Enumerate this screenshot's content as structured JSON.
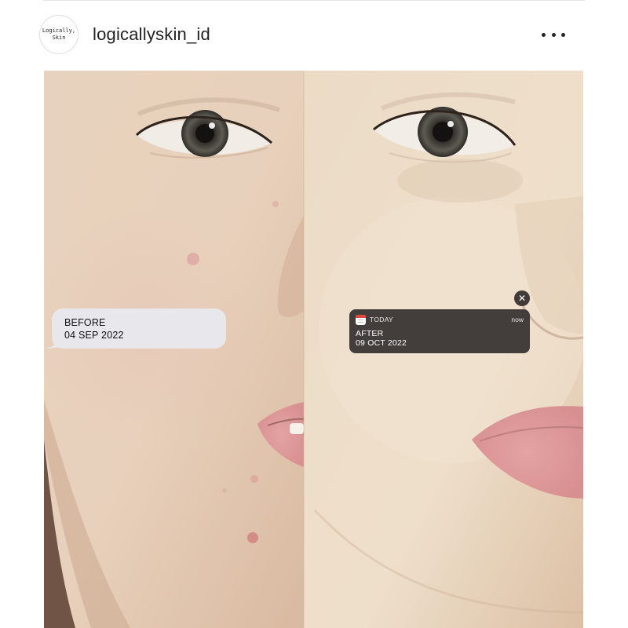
{
  "post": {
    "username": "logicallyskin_id",
    "avatar_text": "Logically,\nSkin",
    "more_icon": "more-horizontal-icon"
  },
  "image": {
    "before": {
      "label": "BEFORE",
      "date": "04 SEP 2022"
    },
    "after_notification": {
      "app_name": "TODAY",
      "time": "now",
      "label": "AFTER",
      "date": "09 OCT 2022",
      "close_symbol": "✕",
      "icon": "calendar-icon"
    }
  },
  "colors": {
    "bubble_bg": "#e8e7ec",
    "notification_bg": "#34302f",
    "calendar_red": "#e0463c"
  }
}
